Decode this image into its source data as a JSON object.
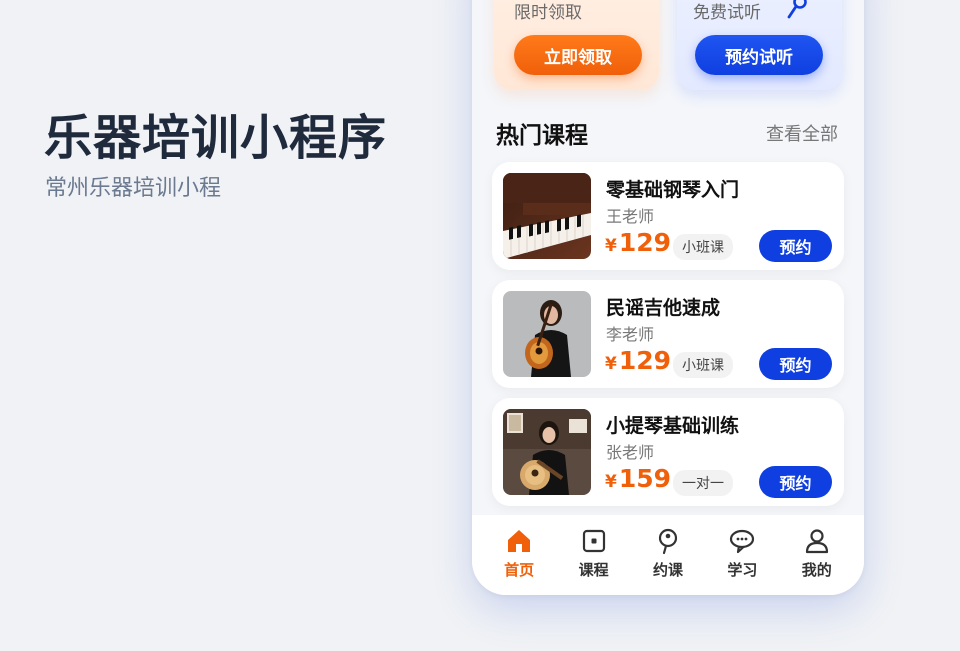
{
  "hero": {
    "title": "乐器培训小程序",
    "subtitle": "常州乐器培训小程"
  },
  "promos": [
    {
      "text": "限时领取",
      "button": "立即领取",
      "color": "#f0600a"
    },
    {
      "text": "免费试听",
      "button": "预约试听",
      "color": "#0f3fe0",
      "icon": "pin-icon"
    }
  ],
  "section": {
    "title": "热门课程",
    "see_all": "查看全部"
  },
  "courses": [
    {
      "name": "零基础钢琴入门",
      "teacher": "王老师",
      "currency": "¥",
      "price": "129",
      "tag": "小班课",
      "button": "预约",
      "image": "piano-photo"
    },
    {
      "name": "民谣吉他速成",
      "teacher": "李老师",
      "currency": "¥",
      "price": "129",
      "tag": "小班课",
      "button": "预约",
      "image": "guitarist-photo"
    },
    {
      "name": "小提琴基础训练",
      "teacher": "张老师",
      "currency": "¥",
      "price": "159",
      "tag": "一对一",
      "button": "预约",
      "image": "teacher-guitar-photo"
    }
  ],
  "tabbar": [
    {
      "label": "首页",
      "icon": "home-icon",
      "active": true
    },
    {
      "label": "课程",
      "icon": "course-icon",
      "active": false
    },
    {
      "label": "约课",
      "icon": "pin-icon",
      "active": false
    },
    {
      "label": "学习",
      "icon": "chat-icon",
      "active": false
    },
    {
      "label": "我的",
      "icon": "user-icon",
      "active": false
    }
  ],
  "colors": {
    "accent_orange": "#f0600a",
    "accent_blue": "#0f3fe0",
    "title": "#1f2a3d"
  }
}
